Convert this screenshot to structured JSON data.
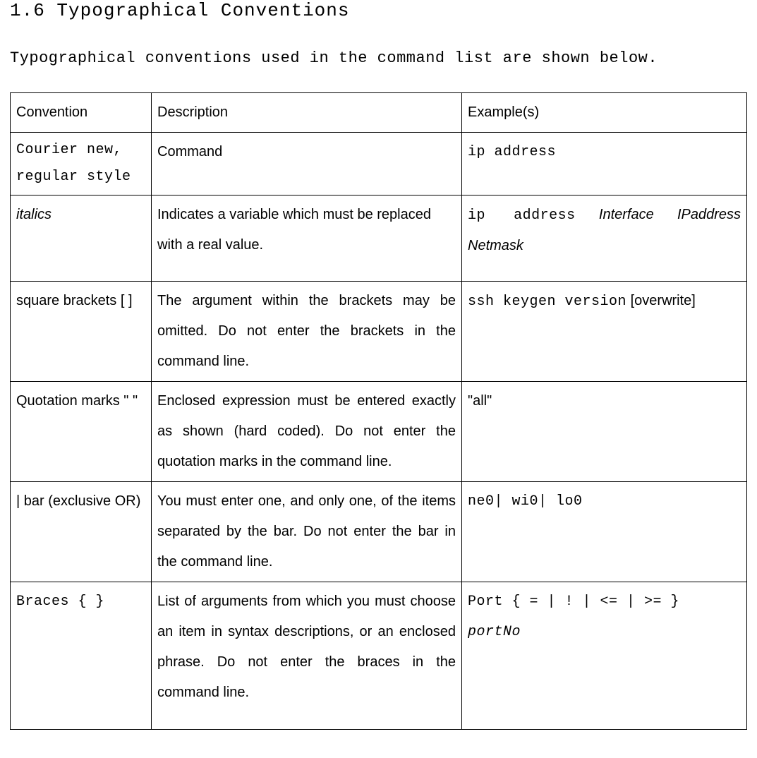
{
  "heading": "1.6 Typographical Conventions",
  "intro": "Typographical conventions used in the command list are shown below.",
  "table": {
    "headers": {
      "col1": "Convention",
      "col2": "Description",
      "col3": "Example(s)"
    },
    "rows": {
      "r0": {
        "conv": "Courier new, regular style",
        "desc": "Command",
        "ex_mono": "ip address"
      },
      "r1": {
        "conv": "italics",
        "desc": "Indicates a variable which must be replaced with a real value.",
        "ex_mono": "ip  address",
        "ex_ital": "  Interface    IPaddress Netmask"
      },
      "r2": {
        "conv": "square brackets [  ]",
        "desc": "The argument within the brackets may be omitted. Do not enter the brackets in the command line.",
        "ex_mono": "ssh keygen version",
        "ex_sans": " [overwrite]"
      },
      "r3": {
        "conv": "Quotation marks \" \"",
        "desc": "Enclosed expression must be entered exactly as shown (hard coded). Do not enter the quotation marks in the command line.",
        "ex_sans": "\"all\""
      },
      "r4": {
        "conv": "| bar (exclusive OR)",
        "desc": "You must enter one, and only one, of the items separated by the bar. Do not enter the bar in the command line.",
        "ex_mono": "ne0| wi0| lo0"
      },
      "r5": {
        "conv": "Braces { }",
        "desc": "List of arguments from which you must choose an item in syntax descriptions, or an enclosed phrase. Do not enter the braces in the command line.",
        "ex_mono": "Port { = | ! | <= | >= } ",
        "ex_mono_ital": "portNo"
      }
    }
  }
}
